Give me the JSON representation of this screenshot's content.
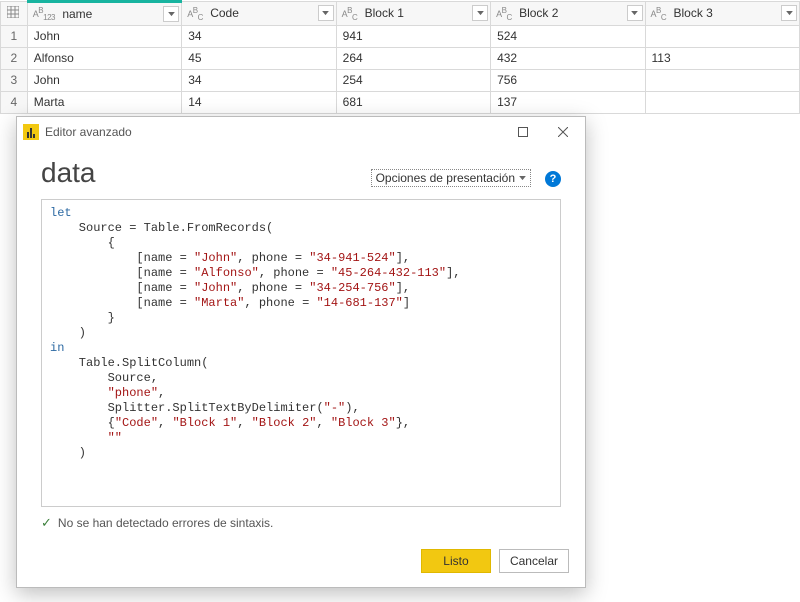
{
  "table": {
    "columns": [
      {
        "type_icon": "ABC123",
        "label": "name",
        "selected": true
      },
      {
        "type_icon": "ABC",
        "label": "Code",
        "selected": false
      },
      {
        "type_icon": "ABC",
        "label": "Block 1",
        "selected": false
      },
      {
        "type_icon": "ABC",
        "label": "Block 2",
        "selected": false
      },
      {
        "type_icon": "ABC",
        "label": "Block 3",
        "selected": false
      }
    ],
    "rows": [
      {
        "n": "1",
        "cells": [
          "John",
          "34",
          "941",
          "524",
          ""
        ]
      },
      {
        "n": "2",
        "cells": [
          "Alfonso",
          "45",
          "264",
          "432",
          "113"
        ]
      },
      {
        "n": "3",
        "cells": [
          "John",
          "34",
          "254",
          "756",
          ""
        ]
      },
      {
        "n": "4",
        "cells": [
          "Marta",
          "14",
          "681",
          "137",
          ""
        ]
      }
    ]
  },
  "dialog": {
    "title": "Editor avanzado",
    "query_name": "data",
    "options_link": "Opciones de presentación",
    "help_tooltip": "?",
    "status_text": "No se han detectado errores de sintaxis.",
    "btn_ok": "Listo",
    "btn_cancel": "Cancelar",
    "code": {
      "l01a": "let",
      "l02a": "    Source = Table.FromRecords(",
      "l03a": "        {",
      "l04a": "            [name = ",
      "l04b": "\"John\"",
      "l04c": ", phone = ",
      "l04d": "\"34-941-524\"",
      "l04e": "],",
      "l05a": "            [name = ",
      "l05b": "\"Alfonso\"",
      "l05c": ", phone = ",
      "l05d": "\"45-264-432-113\"",
      "l05e": "],",
      "l06a": "            [name = ",
      "l06b": "\"John\"",
      "l06c": ", phone = ",
      "l06d": "\"34-254-756\"",
      "l06e": "],",
      "l07a": "            [name = ",
      "l07b": "\"Marta\"",
      "l07c": ", phone = ",
      "l07d": "\"14-681-137\"",
      "l07e": "]",
      "l08a": "        }",
      "l09a": "    )",
      "l10a": "in",
      "l11a": "    Table.SplitColumn(",
      "l12a": "        Source,",
      "l13a": "        ",
      "l13b": "\"phone\"",
      "l13c": ",",
      "l14a": "        Splitter.SplitTextByDelimiter(",
      "l14b": "\"-\"",
      "l14c": "),",
      "l15a": "        {",
      "l15b": "\"Code\"",
      "l15c": ", ",
      "l15d": "\"Block 1\"",
      "l15e": ", ",
      "l15f": "\"Block 2\"",
      "l15g": ", ",
      "l15h": "\"Block 3\"",
      "l15i": "},",
      "l16a": "        ",
      "l16b": "\"\"",
      "l17a": "    )"
    }
  }
}
